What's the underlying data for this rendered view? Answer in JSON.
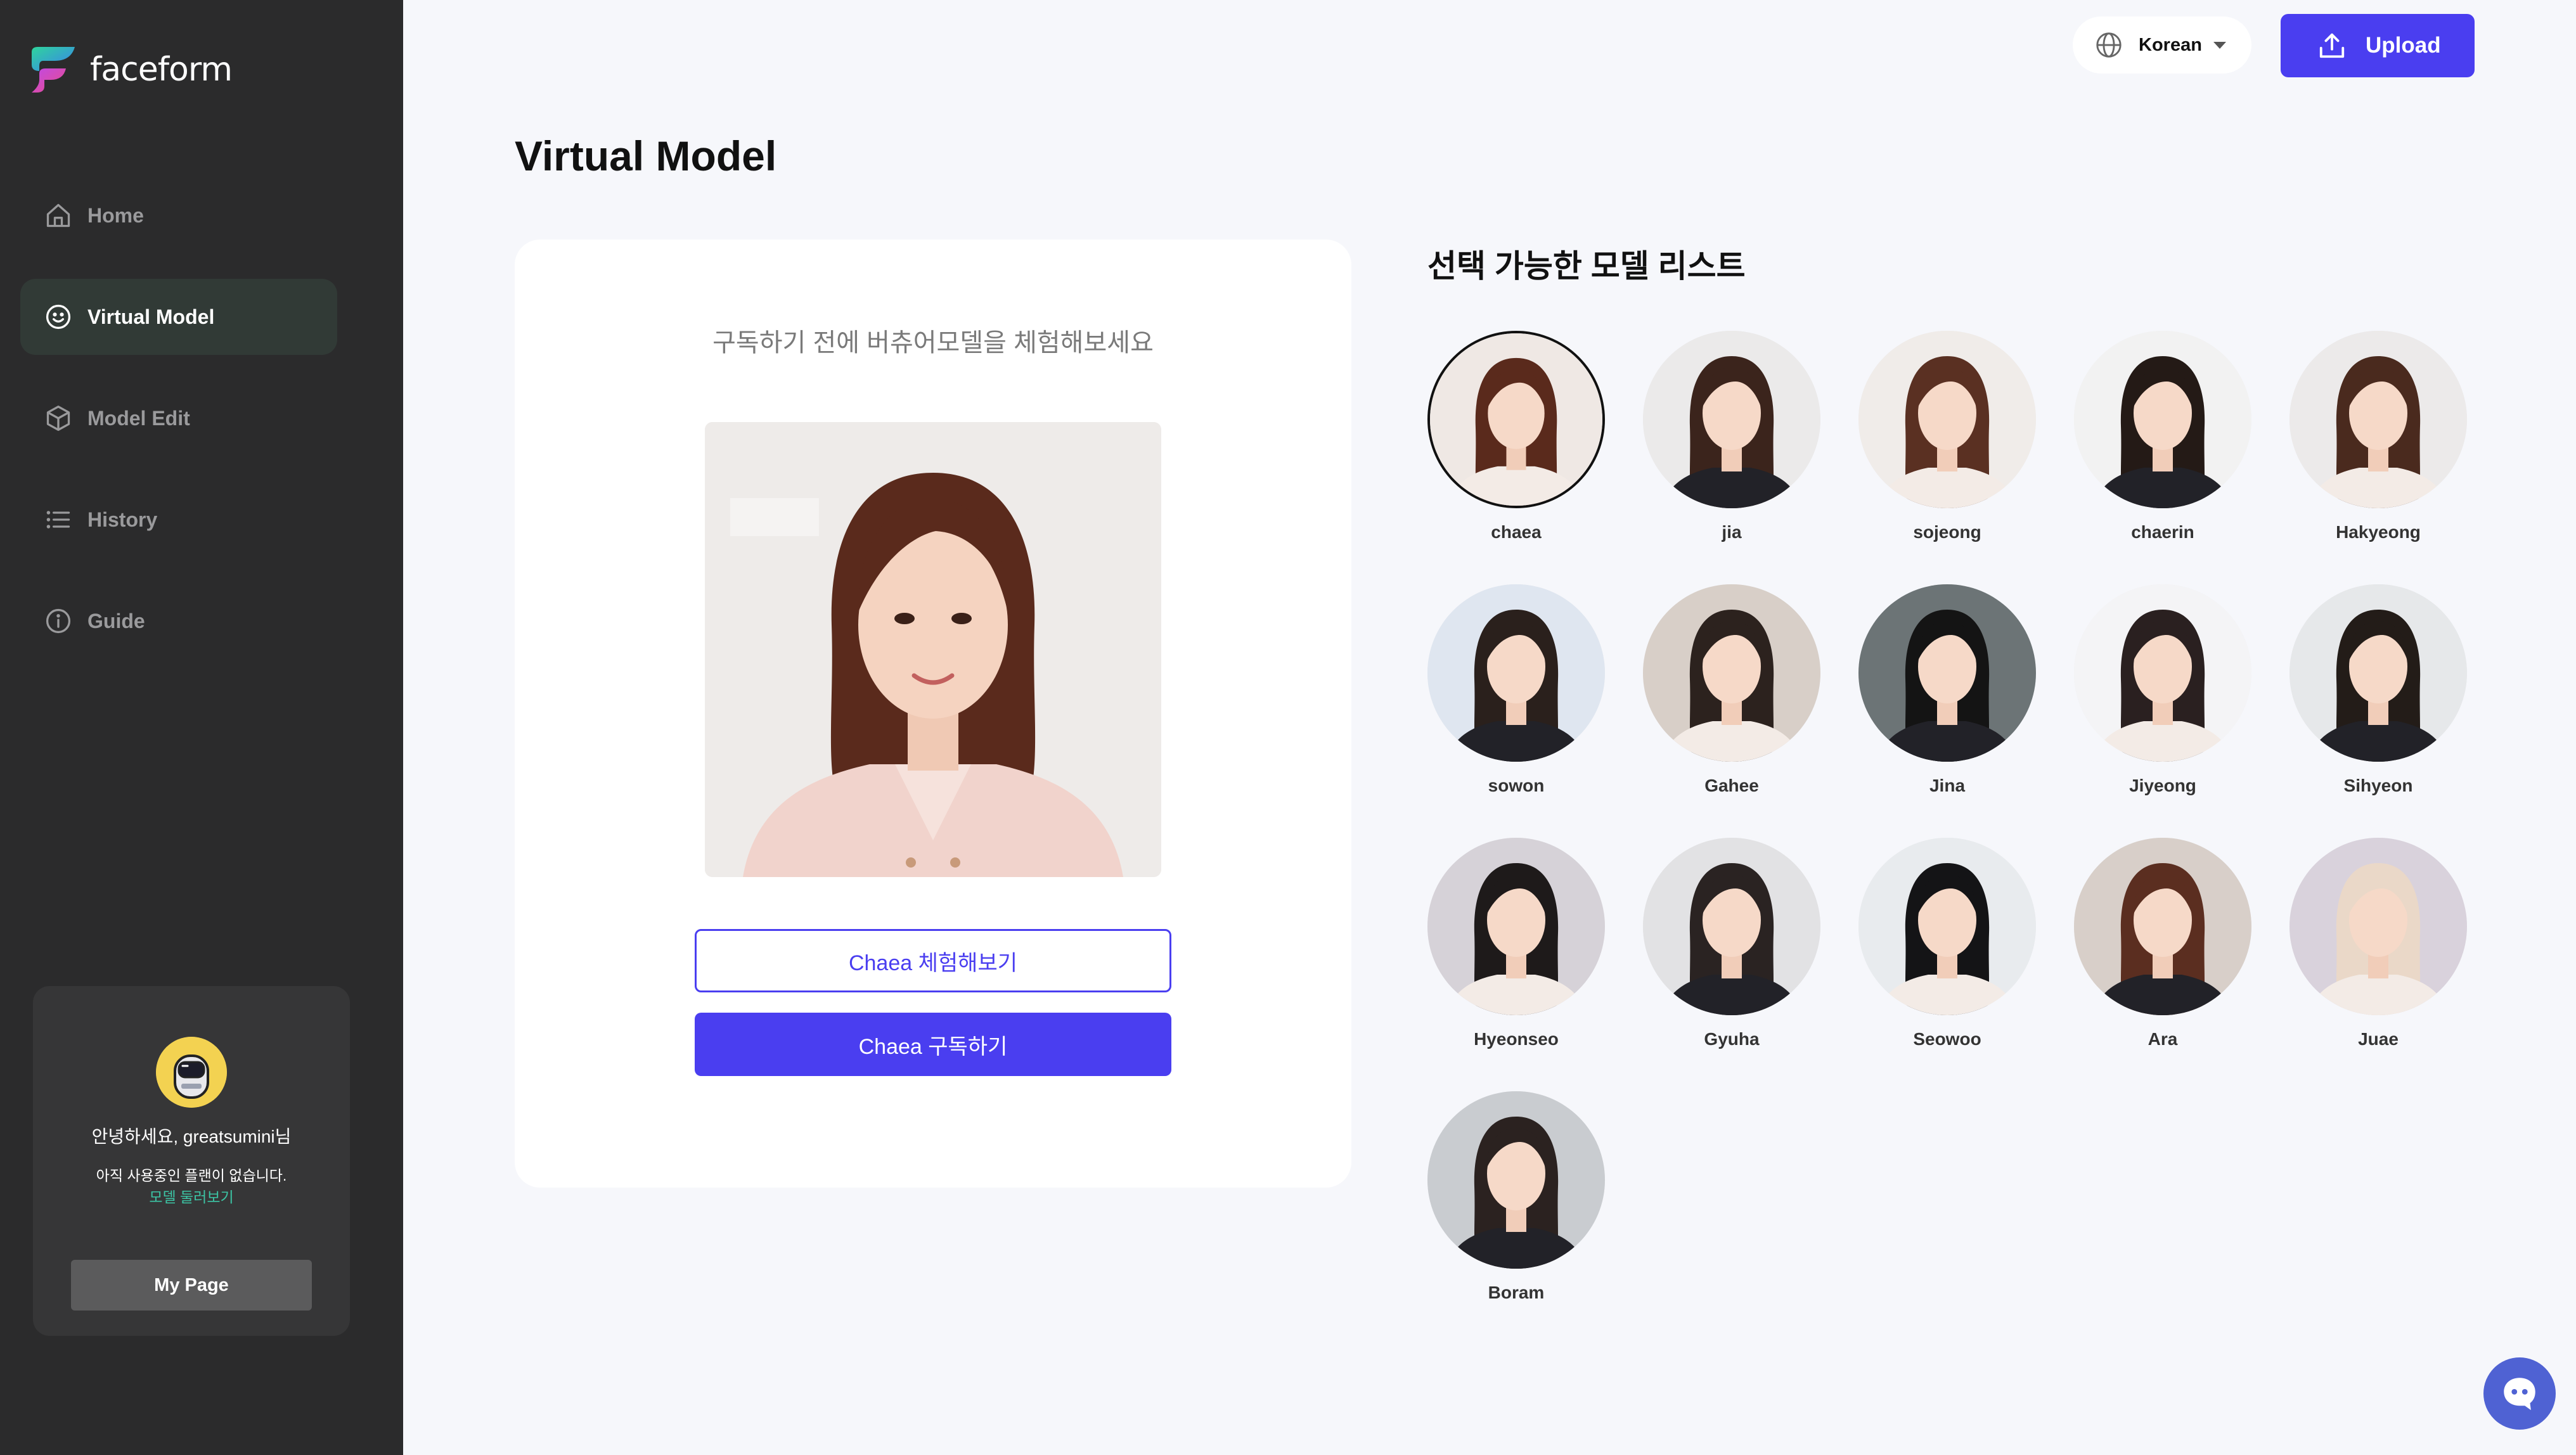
{
  "app": {
    "name": "faceform"
  },
  "sidebar": {
    "items": [
      {
        "label": "Home",
        "icon": "home-icon",
        "active": false
      },
      {
        "label": "Virtual Model",
        "icon": "smile-icon",
        "active": true
      },
      {
        "label": "Model Edit",
        "icon": "cube-icon",
        "active": false
      },
      {
        "label": "History",
        "icon": "list-icon",
        "active": false
      },
      {
        "label": "Guide",
        "icon": "info-icon",
        "active": false
      }
    ],
    "profile": {
      "greeting": "안녕하세요, greatsumini님",
      "no_plan": "아직 사용중인 플랜이 없습니다.",
      "browse_link": "모델 둘러보기",
      "mypage_label": "My Page"
    }
  },
  "header": {
    "language": "Korean",
    "upload_label": "Upload"
  },
  "page": {
    "title": "Virtual Model"
  },
  "preview": {
    "subtitle": "구독하기 전에 버츄어모델을 체험해보세요",
    "try_label": "Chaea 체험해보기",
    "subscribe_label": "Chaea 구독하기"
  },
  "model_list": {
    "title": "선택 가능한 모델 리스트",
    "models": [
      {
        "name": "chaea",
        "selected": true
      },
      {
        "name": "jia"
      },
      {
        "name": "sojeong"
      },
      {
        "name": "chaerin"
      },
      {
        "name": "Hakyeong"
      },
      {
        "name": "sowon"
      },
      {
        "name": "Gahee"
      },
      {
        "name": "Jina"
      },
      {
        "name": "Jiyeong"
      },
      {
        "name": "Sihyeon"
      },
      {
        "name": "Hyeonseo"
      },
      {
        "name": "Gyuha"
      },
      {
        "name": "Seowoo"
      },
      {
        "name": "Ara"
      },
      {
        "name": "Juae"
      },
      {
        "name": "Boram"
      }
    ]
  },
  "colors": {
    "accent": "#4a3ef0",
    "sidebar_bg": "#2b2b2c",
    "link_green": "#3cc4a4",
    "chat_fab": "#4f62d3"
  }
}
